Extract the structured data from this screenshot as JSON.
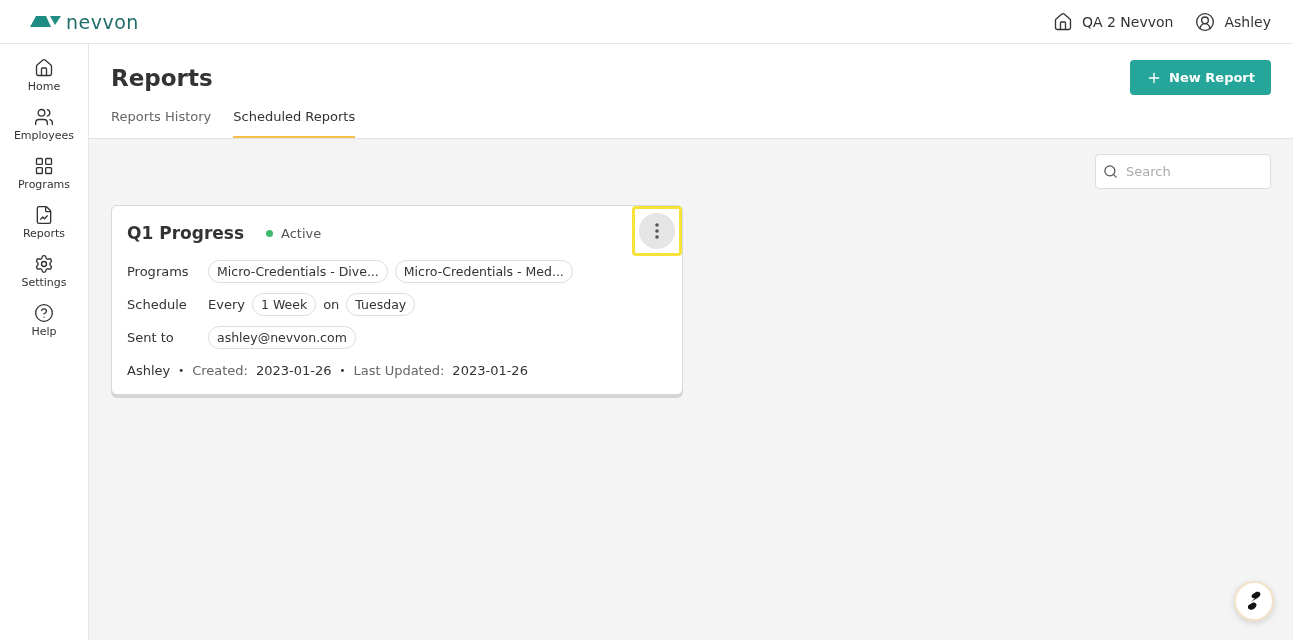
{
  "header": {
    "logo_text": "nevvon",
    "organization": "QA 2 Nevvon",
    "user": "Ashley"
  },
  "sidebar": {
    "items": [
      {
        "kind": "home",
        "label": "Home"
      },
      {
        "kind": "employees",
        "label": "Employees"
      },
      {
        "kind": "programs",
        "label": "Programs"
      },
      {
        "kind": "reports",
        "label": "Reports"
      },
      {
        "kind": "settings",
        "label": "Settings"
      },
      {
        "kind": "help",
        "label": "Help"
      }
    ]
  },
  "page": {
    "title": "Reports",
    "new_button": "New Report",
    "search": {
      "placeholder": "Search"
    }
  },
  "tabs": [
    {
      "label": "Reports History",
      "selected": false
    },
    {
      "label": "Scheduled Reports",
      "selected": true
    }
  ],
  "cards": [
    {
      "title": "Q1 Progress",
      "status": "Active",
      "color": "#3dba6f",
      "menu_highlighted": true,
      "programs_label": "Programs",
      "programs": [
        "Micro-Credentials - Dive...",
        "Micro-Credentials - Med..."
      ],
      "schedule_label": "Schedule",
      "schedule": [
        {
          "kind": "word",
          "text": "Every"
        },
        {
          "kind": "chip",
          "text": "1 Week"
        },
        {
          "kind": "word",
          "text": "on"
        },
        {
          "kind": "chip",
          "text": "Tuesday"
        }
      ],
      "sent_to_label": "Sent to",
      "recipients": [
        "ashley@nevvon.com"
      ],
      "meta": [
        {
          "kind": "value",
          "text": "Ashley"
        },
        {
          "kind": "separator",
          "text": "•"
        },
        {
          "kind": "label",
          "text": "Created:"
        },
        {
          "kind": "value",
          "text": "2023-01-26"
        },
        {
          "kind": "separator",
          "text": "•"
        },
        {
          "kind": "label",
          "text": "Last Updated:"
        },
        {
          "kind": "value",
          "text": "2023-01-26"
        }
      ]
    }
  ]
}
